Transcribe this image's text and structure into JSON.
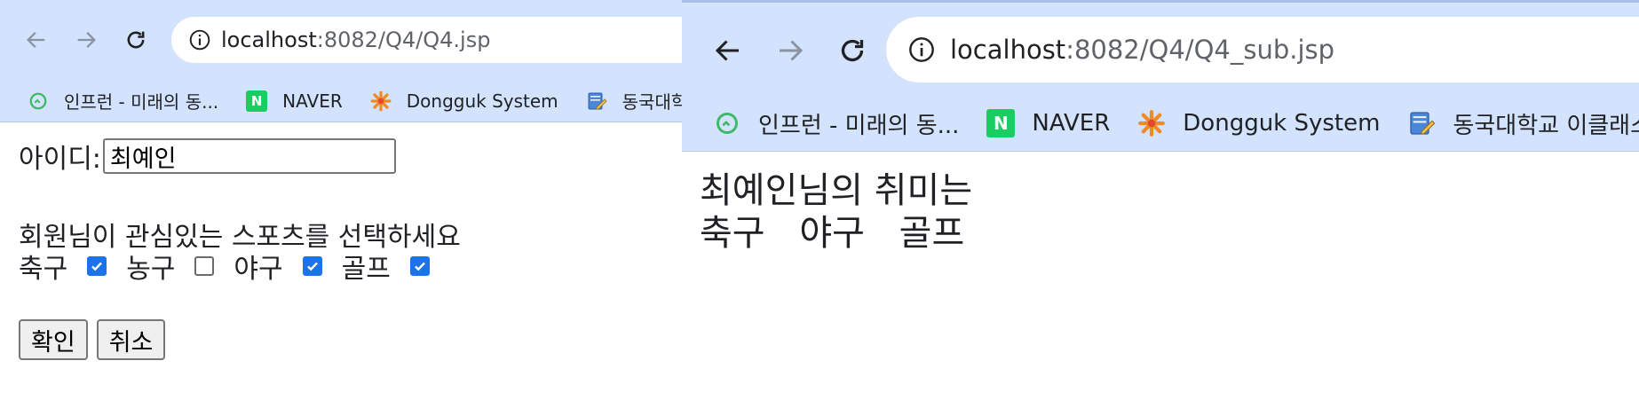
{
  "left_window": {
    "url_host": "localhost",
    "url_path": ":8082/Q4/Q4.jsp",
    "bookmarks": [
      {
        "label": "인프런 - 미래의 동...",
        "icon": "inflearn-icon"
      },
      {
        "label": "NAVER",
        "icon": "naver-icon",
        "badge": "N"
      },
      {
        "label": "Dongguk System",
        "icon": "dongguk-icon"
      },
      {
        "label": "동국대학",
        "icon": "notepad-icon"
      }
    ],
    "form": {
      "id_label": "아이디:",
      "id_value": "최예인",
      "prompt": "회원님이 관심있는 스포츠를 선택하세요",
      "sports": [
        {
          "label": "축구",
          "checked": true
        },
        {
          "label": "농구",
          "checked": false
        },
        {
          "label": "야구",
          "checked": true
        },
        {
          "label": "골프",
          "checked": true
        }
      ],
      "submit_label": "확인",
      "reset_label": "취소"
    }
  },
  "right_window": {
    "url_host": "localhost",
    "url_path": ":8082/Q4/Q4_sub.jsp",
    "bookmarks": [
      {
        "label": "인프런 - 미래의 동...",
        "icon": "inflearn-icon"
      },
      {
        "label": "NAVER",
        "icon": "naver-icon",
        "badge": "N"
      },
      {
        "label": "Dongguk System",
        "icon": "dongguk-icon"
      },
      {
        "label": "동국대학교 이클래스",
        "icon": "notepad-icon"
      }
    ],
    "result": {
      "heading": "최예인님의 취미는",
      "hobbies": [
        "축구",
        "야구",
        "골프"
      ]
    }
  },
  "colors": {
    "toolbar_bg": "#d3e3fd",
    "checkbox_checked": "#1a73e8",
    "naver_green": "#19ce60"
  }
}
